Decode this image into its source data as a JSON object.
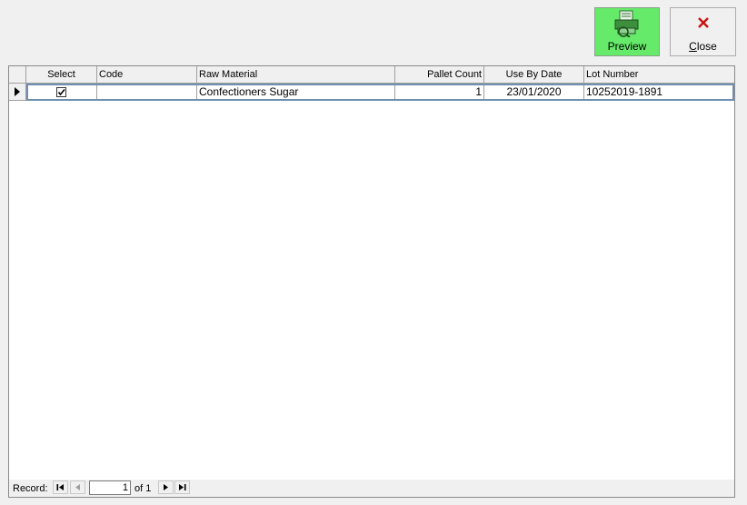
{
  "toolbar": {
    "preview_label": "Preview",
    "close_label": "Close",
    "preview_color": "#66ea6a"
  },
  "grid": {
    "columns": [
      "Select",
      "Code",
      "Raw Material",
      "Pallet Count",
      "Use By Date",
      "Lot Number"
    ],
    "rows": [
      {
        "select": true,
        "code": "",
        "raw_material": "Confectioners Sugar",
        "pallet_count": "1",
        "use_by_date": "23/01/2020",
        "lot_number": "10252019-1891"
      }
    ]
  },
  "navigator": {
    "label": "Record:",
    "current": "1",
    "of_text": "of 1"
  },
  "icons": {
    "preview": "printer-preview-icon",
    "close": "red-x-icon"
  }
}
